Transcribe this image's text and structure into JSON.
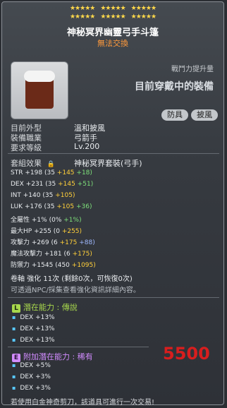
{
  "stars_row1": [
    "★★★★★",
    "★★★★★",
    "★★★★★"
  ],
  "stars_row2": [
    "★★★★★",
    "★★★★★",
    "★★★★★"
  ],
  "item": {
    "name": "神秘冥界幽靈弓手斗篷",
    "trade": "無法交換",
    "icon": "cape-icon"
  },
  "combat_power_label": "戰鬥力提升量",
  "current_equipped": "目前穿戴中的裝備",
  "badges": [
    "防具",
    "披風"
  ],
  "details": [
    {
      "label": "目前外型",
      "value": "溫和披風"
    },
    {
      "label": "裝備職業",
      "value": "弓箭手"
    },
    {
      "label": "要求等級",
      "value": "Lv.200"
    }
  ],
  "set_effect": {
    "label": "套組效果",
    "value": "神秘冥界套裝(弓手)"
  },
  "stats": [
    {
      "name": "STR",
      "total": "+198",
      "base": "(35",
      "flame": "+145",
      "star": "+18)"
    },
    {
      "name": "DEX",
      "total": "+231",
      "base": "(35",
      "flame": "+145",
      "star": "+51)"
    },
    {
      "name": "INT",
      "total": "+140",
      "base": "(35",
      "flame": "+105)",
      "star": ""
    },
    {
      "name": "LUK",
      "total": "+176",
      "base": "(35",
      "flame": "+105",
      "star": "+36)"
    },
    {
      "name": "全屬性",
      "total": "+1%",
      "base": "(0%",
      "flame": "",
      "star": "+1%)"
    },
    {
      "name": "最大HP",
      "total": "+255",
      "base": "(0",
      "flame": "+255)",
      "star": ""
    },
    {
      "name": "攻擊力",
      "total": "+269",
      "base": "(6",
      "flame": "+175",
      "star": "+88)"
    },
    {
      "name": "魔法攻擊力",
      "total": "+181",
      "base": "(6",
      "flame": "+175)",
      "star": ""
    },
    {
      "name": "防禦力",
      "total": "+1545",
      "base": "(450",
      "flame": "+1095)",
      "star": ""
    }
  ],
  "scroll_line": "卷軸 強化 11次 (剩餘0次，可恢復0次)",
  "npc_note": "可透過NPC/採集查看強化資訊詳細內容。",
  "potential": {
    "icon_letter": "L",
    "label": "潛在能力 : ",
    "grade": "傳說",
    "lines": [
      "DEX +13%",
      "DEX +13%",
      "DEX +13%"
    ]
  },
  "additional_potential": {
    "icon_letter": "E",
    "label": "附加潛在能力 : ",
    "grade": "稀有",
    "lines": [
      "DEX +5%",
      "DEX +3%",
      "DEX +3%"
    ]
  },
  "price": "5500",
  "footer": "若使用白金神奇剪刀，該道具可進行一次交易!",
  "colors": {
    "title": "#ffffff",
    "trade": "#ff9a3c",
    "price": "#d81e1e",
    "legendary": "#a8d84c",
    "epic": "#d28cff"
  }
}
